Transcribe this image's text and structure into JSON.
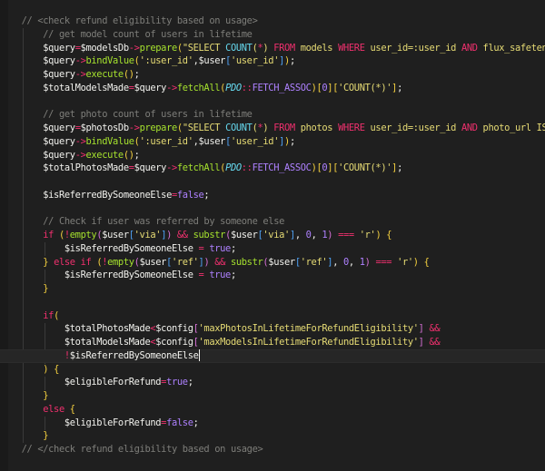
{
  "editor": {
    "active_line": 26,
    "cursor_after_line": 26,
    "lines": [
      [
        [
          "c",
          "    // <check refund eligibility based on usage>"
        ]
      ],
      [
        [
          "c",
          "        // get model count of users in lifetime"
        ]
      ],
      [
        [
          "v",
          "        $query"
        ],
        [
          "o",
          "="
        ],
        [
          "v",
          "$modelsDb"
        ],
        [
          "o",
          "->"
        ],
        [
          "f",
          "prepare"
        ],
        [
          "b",
          "("
        ],
        [
          "s",
          "\"SELECT "
        ],
        [
          "q",
          "COUNT"
        ],
        [
          "s",
          "("
        ],
        [
          "o",
          "*"
        ],
        [
          "s",
          ") "
        ],
        [
          "k",
          "FROM"
        ],
        [
          "s",
          " models "
        ],
        [
          "k",
          "WHERE"
        ],
        [
          "s",
          " user_id=:user_id "
        ],
        [
          "k",
          "AND"
        ],
        [
          "s",
          " flux_safetensors"
        ]
      ],
      [
        [
          "v",
          "        $query"
        ],
        [
          "o",
          "->"
        ],
        [
          "f",
          "bindValue"
        ],
        [
          "b",
          "("
        ],
        [
          "s",
          "':user_id'"
        ],
        [
          "p",
          ","
        ],
        [
          "v",
          "$user"
        ],
        [
          "bb",
          "["
        ],
        [
          "s",
          "'user_id'"
        ],
        [
          "bb",
          "]"
        ],
        [
          "b",
          ")"
        ],
        [
          "p",
          ";"
        ]
      ],
      [
        [
          "v",
          "        $query"
        ],
        [
          "o",
          "->"
        ],
        [
          "f",
          "execute"
        ],
        [
          "b",
          "()"
        ],
        [
          "p",
          ";"
        ]
      ],
      [
        [
          "v",
          "        $totalModelsMade"
        ],
        [
          "o",
          "="
        ],
        [
          "v",
          "$query"
        ],
        [
          "o",
          "->"
        ],
        [
          "f",
          "fetchAll"
        ],
        [
          "b",
          "("
        ],
        [
          "cl",
          "PDO"
        ],
        [
          "o",
          "::"
        ],
        [
          "n",
          "FETCH_ASSOC"
        ],
        [
          "b",
          ")"
        ],
        [
          "b",
          "["
        ],
        [
          "n",
          "0"
        ],
        [
          "b",
          "]"
        ],
        [
          "b",
          "["
        ],
        [
          "s",
          "'COUNT(*)'"
        ],
        [
          "b",
          "]"
        ],
        [
          "p",
          ";"
        ]
      ],
      [],
      [
        [
          "c",
          "        // get photo count of users in lifetime"
        ]
      ],
      [
        [
          "v",
          "        $query"
        ],
        [
          "o",
          "="
        ],
        [
          "v",
          "$photosDb"
        ],
        [
          "o",
          "->"
        ],
        [
          "f",
          "prepare"
        ],
        [
          "b",
          "("
        ],
        [
          "s",
          "\"SELECT "
        ],
        [
          "q",
          "COUNT"
        ],
        [
          "s",
          "("
        ],
        [
          "o",
          "*"
        ],
        [
          "s",
          ") "
        ],
        [
          "k",
          "FROM"
        ],
        [
          "s",
          " photos "
        ],
        [
          "k",
          "WHERE"
        ],
        [
          "s",
          " user_id=:user_id "
        ],
        [
          "k",
          "AND"
        ],
        [
          "s",
          " photo_url IS"
        ]
      ],
      [
        [
          "v",
          "        $query"
        ],
        [
          "o",
          "->"
        ],
        [
          "f",
          "bindValue"
        ],
        [
          "b",
          "("
        ],
        [
          "s",
          "':user_id'"
        ],
        [
          "p",
          ","
        ],
        [
          "v",
          "$user"
        ],
        [
          "bb",
          "["
        ],
        [
          "s",
          "'user_id'"
        ],
        [
          "bb",
          "]"
        ],
        [
          "b",
          ")"
        ],
        [
          "p",
          ";"
        ]
      ],
      [
        [
          "v",
          "        $query"
        ],
        [
          "o",
          "->"
        ],
        [
          "f",
          "execute"
        ],
        [
          "b",
          "()"
        ],
        [
          "p",
          ";"
        ]
      ],
      [
        [
          "v",
          "        $totalPhotosMade"
        ],
        [
          "o",
          "="
        ],
        [
          "v",
          "$query"
        ],
        [
          "o",
          "->"
        ],
        [
          "f",
          "fetchAll"
        ],
        [
          "b",
          "("
        ],
        [
          "cl",
          "PDO"
        ],
        [
          "o",
          "::"
        ],
        [
          "n",
          "FETCH_ASSOC"
        ],
        [
          "b",
          ")"
        ],
        [
          "b",
          "["
        ],
        [
          "n",
          "0"
        ],
        [
          "b",
          "]"
        ],
        [
          "b",
          "["
        ],
        [
          "s",
          "'COUNT(*)'"
        ],
        [
          "b",
          "]"
        ],
        [
          "p",
          ";"
        ]
      ],
      [],
      [
        [
          "v",
          "        $isReferredBySomeoneElse"
        ],
        [
          "o",
          "="
        ],
        [
          "n",
          "false"
        ],
        [
          "p",
          ";"
        ]
      ],
      [],
      [
        [
          "c",
          "        // Check if user was referred by someone else"
        ]
      ],
      [
        [
          "k",
          "        if"
        ],
        [
          "p",
          " "
        ],
        [
          "b",
          "("
        ],
        [
          "o",
          "!"
        ],
        [
          "f",
          "empty"
        ],
        [
          "bp",
          "("
        ],
        [
          "v",
          "$user"
        ],
        [
          "bb",
          "["
        ],
        [
          "s",
          "'via'"
        ],
        [
          "bb",
          "]"
        ],
        [
          "bp",
          ")"
        ],
        [
          "p",
          " "
        ],
        [
          "o",
          "&&"
        ],
        [
          "p",
          " "
        ],
        [
          "f",
          "substr"
        ],
        [
          "bp",
          "("
        ],
        [
          "v",
          "$user"
        ],
        [
          "bb",
          "["
        ],
        [
          "s",
          "'via'"
        ],
        [
          "bb",
          "]"
        ],
        [
          "p",
          ", "
        ],
        [
          "n",
          "0"
        ],
        [
          "p",
          ", "
        ],
        [
          "n",
          "1"
        ],
        [
          "bp",
          ")"
        ],
        [
          "p",
          " "
        ],
        [
          "o",
          "==="
        ],
        [
          "p",
          " "
        ],
        [
          "s",
          "'r'"
        ],
        [
          "b",
          ")"
        ],
        [
          "p",
          " "
        ],
        [
          "b",
          "{"
        ]
      ],
      [
        [
          "v",
          "            $isReferredBySomeoneElse"
        ],
        [
          "p",
          " "
        ],
        [
          "o",
          "="
        ],
        [
          "p",
          " "
        ],
        [
          "n",
          "true"
        ],
        [
          "p",
          ";"
        ]
      ],
      [
        [
          "b",
          "        }"
        ],
        [
          "p",
          " "
        ],
        [
          "k",
          "else if"
        ],
        [
          "p",
          " "
        ],
        [
          "b",
          "("
        ],
        [
          "o",
          "!"
        ],
        [
          "f",
          "empty"
        ],
        [
          "bp",
          "("
        ],
        [
          "v",
          "$user"
        ],
        [
          "bb",
          "["
        ],
        [
          "s",
          "'ref'"
        ],
        [
          "bb",
          "]"
        ],
        [
          "bp",
          ")"
        ],
        [
          "p",
          " "
        ],
        [
          "o",
          "&&"
        ],
        [
          "p",
          " "
        ],
        [
          "f",
          "substr"
        ],
        [
          "bp",
          "("
        ],
        [
          "v",
          "$user"
        ],
        [
          "bb",
          "["
        ],
        [
          "s",
          "'ref'"
        ],
        [
          "bb",
          "]"
        ],
        [
          "p",
          ", "
        ],
        [
          "n",
          "0"
        ],
        [
          "p",
          ", "
        ],
        [
          "n",
          "1"
        ],
        [
          "bp",
          ")"
        ],
        [
          "p",
          " "
        ],
        [
          "o",
          "==="
        ],
        [
          "p",
          " "
        ],
        [
          "s",
          "'r'"
        ],
        [
          "b",
          ")"
        ],
        [
          "p",
          " "
        ],
        [
          "b",
          "{"
        ]
      ],
      [
        [
          "v",
          "            $isReferredBySomeoneElse"
        ],
        [
          "p",
          " "
        ],
        [
          "o",
          "="
        ],
        [
          "p",
          " "
        ],
        [
          "n",
          "true"
        ],
        [
          "p",
          ";"
        ]
      ],
      [
        [
          "b",
          "        }"
        ]
      ],
      [],
      [
        [
          "k",
          "        if"
        ],
        [
          "b",
          "("
        ]
      ],
      [
        [
          "v",
          "            $totalPhotosMade"
        ],
        [
          "o",
          "<"
        ],
        [
          "v",
          "$config"
        ],
        [
          "bp",
          "["
        ],
        [
          "s",
          "'maxPhotosInLifetimeForRefundEligibility'"
        ],
        [
          "bp",
          "]"
        ],
        [
          "p",
          " "
        ],
        [
          "o",
          "&&"
        ]
      ],
      [
        [
          "v",
          "            $totalModelsMade"
        ],
        [
          "o",
          "<"
        ],
        [
          "v",
          "$config"
        ],
        [
          "bp",
          "["
        ],
        [
          "s",
          "'maxModelsInLifetimeForRefundEligibility'"
        ],
        [
          "bp",
          "]"
        ],
        [
          "p",
          " "
        ],
        [
          "o",
          "&&"
        ]
      ],
      [
        [
          "o",
          "            !"
        ],
        [
          "v",
          "$isReferredBySomeoneElse"
        ]
      ],
      [
        [
          "b",
          "        )"
        ],
        [
          "p",
          " "
        ],
        [
          "b",
          "{"
        ]
      ],
      [
        [
          "v",
          "            $eligibleForRefund"
        ],
        [
          "o",
          "="
        ],
        [
          "n",
          "true"
        ],
        [
          "p",
          ";"
        ]
      ],
      [
        [
          "b",
          "        }"
        ]
      ],
      [
        [
          "k",
          "        else"
        ],
        [
          "p",
          " "
        ],
        [
          "b",
          "{"
        ]
      ],
      [
        [
          "v",
          "            $eligibleForRefund"
        ],
        [
          "o",
          "="
        ],
        [
          "n",
          "false"
        ],
        [
          "p",
          ";"
        ]
      ],
      [
        [
          "b",
          "        }"
        ]
      ],
      [
        [
          "c",
          "    // </check refund eligibility based on usage>"
        ]
      ]
    ]
  }
}
